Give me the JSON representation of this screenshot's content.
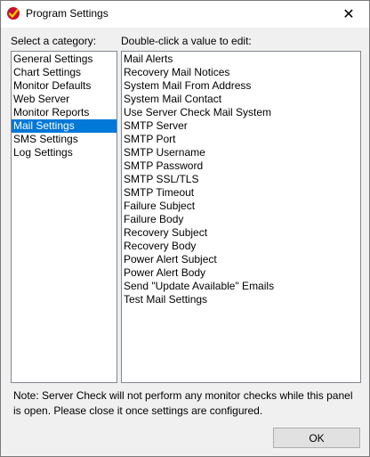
{
  "window": {
    "title": "Program Settings",
    "close_glyph": "✕"
  },
  "categories": {
    "label": "Select a category:",
    "items": [
      {
        "label": "General Settings",
        "selected": false
      },
      {
        "label": "Chart Settings",
        "selected": false
      },
      {
        "label": "Monitor Defaults",
        "selected": false
      },
      {
        "label": "Web Server",
        "selected": false
      },
      {
        "label": "Monitor Reports",
        "selected": false
      },
      {
        "label": "Mail Settings",
        "selected": true
      },
      {
        "label": "SMS Settings",
        "selected": false
      },
      {
        "label": "Log Settings",
        "selected": false
      }
    ]
  },
  "values": {
    "label": "Double-click a value to edit:",
    "items": [
      "Mail Alerts",
      "Recovery Mail Notices",
      "System Mail From Address",
      "System Mail Contact",
      "Use Server Check Mail System",
      "SMTP Server",
      "SMTP Port",
      "SMTP Username",
      "SMTP Password",
      "SMTP SSL/TLS",
      "SMTP Timeout",
      "Failure Subject",
      "Failure Body",
      "Recovery Subject",
      "Recovery Body",
      "Power Alert Subject",
      "Power Alert Body",
      "Send \"Update Available\" Emails",
      "Test Mail Settings"
    ]
  },
  "note": "Note: Server Check will not perform any monitor checks while this panel is open. Please close it once settings are configured.",
  "ok_label": "OK",
  "colors": {
    "selection": "#0078d7",
    "window_bg": "#f0f0f0",
    "list_border": "#828790"
  }
}
